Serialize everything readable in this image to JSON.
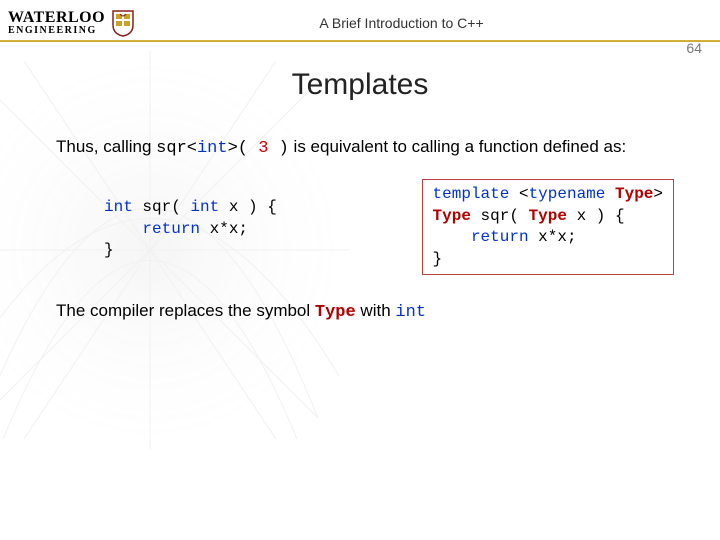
{
  "header": {
    "logo_line1": "WATERLOO",
    "logo_line2": "ENGINEERING",
    "doc_title": "A Brief Introduction to C++",
    "slide_number": "64"
  },
  "slide": {
    "title": "Templates"
  },
  "body": {
    "p1_a": "Thus, calling ",
    "p1_call_1": "sqr<",
    "p1_call_kw": "int",
    "p1_call_2": ">(",
    "p1_call_num": " 3 ",
    "p1_call_3": ")",
    "p1_b": " is equivalent to calling a function defined as:",
    "p2_a": "The compiler replaces the symbol ",
    "p2_type": "Type",
    "p2_b": " with ",
    "p2_int": "int"
  },
  "code_left": {
    "l1a": "int",
    "l1b": " sqr( ",
    "l1c": "int",
    "l1d": " x ) {",
    "l2a": "    ",
    "l2b": "return",
    "l2c": " x*x;",
    "l3": "}"
  },
  "code_right": {
    "l1a": "template",
    "l1b": " <",
    "l1c": "typename",
    "l1d": " ",
    "l1e": "Type",
    "l1f": ">",
    "l2a": "Type",
    "l2b": " sqr( ",
    "l2c": "Type",
    "l2d": " x ) {",
    "l3a": "    ",
    "l3b": "return",
    "l3c": " x*x;",
    "l4": "}"
  }
}
